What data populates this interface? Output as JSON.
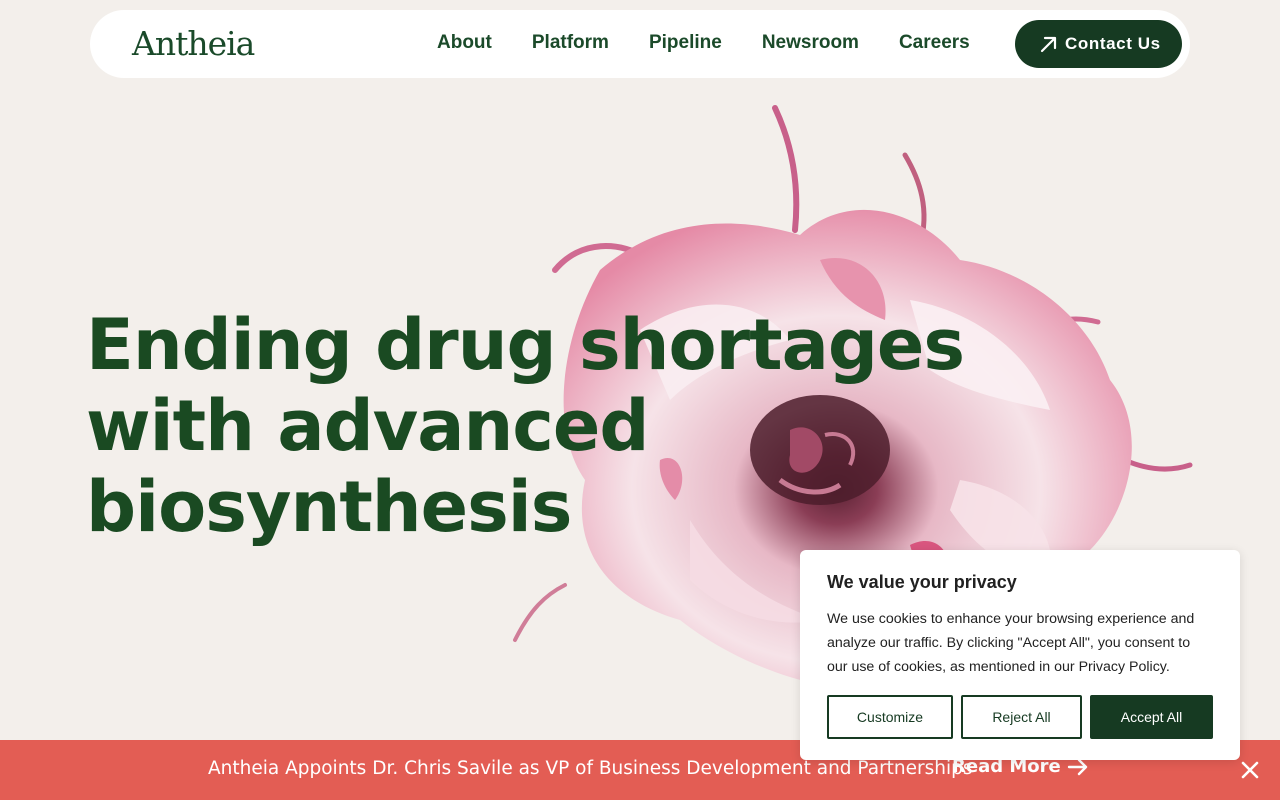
{
  "nav": {
    "logo": "Antheia",
    "links": [
      "About",
      "Platform",
      "Pipeline",
      "Newsroom",
      "Careers"
    ],
    "contact_label": "Contact Us"
  },
  "hero": {
    "lines": [
      "Ending drug shortages",
      "with advanced",
      "biosynthesis"
    ]
  },
  "cookie": {
    "title": "We value your privacy",
    "body": "We use cookies to enhance your browsing experience and analyze our traffic. By clicking \"Accept All\", you consent to our use of cookies, as mentioned in our Privacy Policy.",
    "customize": "Customize",
    "reject": "Reject All",
    "accept": "Accept All"
  },
  "banner": {
    "text": "Antheia Appoints Dr. Chris Savile as VP of Business Development and Partnerships",
    "read_more": "Read More"
  },
  "colors": {
    "brand_green": "#163a22",
    "banner_red": "#e35d54",
    "background": "#f3efeb"
  },
  "icons": {
    "contact": "arrow-up-right-icon",
    "read_more": "arrow-right-icon",
    "close": "close-icon"
  }
}
